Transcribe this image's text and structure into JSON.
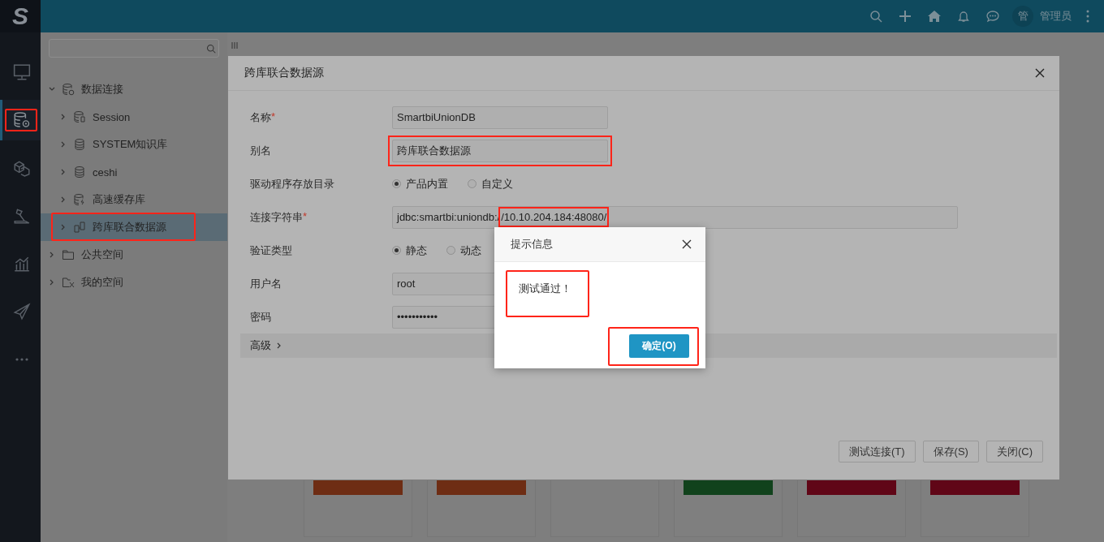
{
  "topbar": {
    "logo": "S",
    "avatar": "管",
    "user": "管理员"
  },
  "rail": [
    {
      "kind": "monitor",
      "selected": false,
      "highlighted": false
    },
    {
      "kind": "database-gear",
      "selected": true,
      "highlighted": true
    },
    {
      "kind": "cubes",
      "selected": false,
      "highlighted": false
    },
    {
      "kind": "tool",
      "selected": false,
      "highlighted": false
    },
    {
      "kind": "chart",
      "selected": false,
      "highlighted": false
    },
    {
      "kind": "plane",
      "selected": false,
      "highlighted": false
    },
    {
      "kind": "more",
      "selected": false,
      "highlighted": false
    }
  ],
  "tree": [
    {
      "label": "数据连接",
      "kind": "group",
      "expanded": true,
      "selected": false,
      "highlighted": false,
      "children": [
        {
          "label": "Session",
          "kind": "session",
          "expanded": false,
          "selected": false,
          "highlighted": false
        },
        {
          "label": "SYSTEM知识库",
          "kind": "database",
          "expanded": false,
          "selected": false,
          "highlighted": false
        },
        {
          "label": "ceshi",
          "kind": "database",
          "expanded": false,
          "selected": false,
          "highlighted": false
        },
        {
          "label": "高速缓存库",
          "kind": "cache",
          "expanded": false,
          "selected": false,
          "highlighted": false
        },
        {
          "label": "跨库联合数据源",
          "kind": "union",
          "expanded": false,
          "selected": true,
          "highlighted": true
        }
      ]
    },
    {
      "label": "公共空间",
      "kind": "folder",
      "expanded": false,
      "selected": false,
      "highlighted": false
    },
    {
      "label": "我的空间",
      "kind": "personal",
      "expanded": false,
      "selected": false,
      "highlighted": false
    }
  ],
  "cards": [
    {
      "kind": "strip",
      "color": "#6e2d14"
    },
    {
      "kind": "strip",
      "color": "#6e2d14"
    },
    {
      "kind": "blank"
    },
    {
      "kind": "strip",
      "color": "#11421c"
    },
    {
      "kind": "strip",
      "color": "#600617"
    },
    {
      "kind": "strip",
      "color": "#600617"
    }
  ],
  "dialog": {
    "title": "跨库联合数据源",
    "rows": [
      {
        "kind": "text",
        "label": "名称",
        "required_mark": "*",
        "highlighted": false,
        "value_parts": [
          {
            "text": "SmartbiUnionDB",
            "highlighted": false
          }
        ]
      },
      {
        "kind": "text",
        "label": "别名",
        "highlighted": true,
        "value_parts": [
          {
            "text": "跨库联合数据源",
            "highlighted": false
          }
        ]
      },
      {
        "kind": "radio",
        "label": "驱动程序存放目录",
        "options": [
          {
            "label": "产品内置",
            "selected": true
          },
          {
            "label": "自定义",
            "selected": false
          }
        ]
      },
      {
        "kind": "wide",
        "label": "连接字符串",
        "required_mark": "*",
        "highlighted": false,
        "value_parts": [
          {
            "text": "jdbc:smartbi:uniondb:/",
            "highlighted": false
          },
          {
            "text": "/10.10.204.184:48080/",
            "highlighted": true
          }
        ]
      },
      {
        "kind": "radio",
        "label": "验证类型",
        "options": [
          {
            "label": "静态",
            "selected": true
          },
          {
            "label": "动态",
            "selected": false
          }
        ]
      },
      {
        "kind": "text",
        "label": "用户名",
        "highlighted": false,
        "value_parts": [
          {
            "text": "root",
            "highlighted": false
          }
        ]
      },
      {
        "kind": "text",
        "label": "密码",
        "highlighted": false,
        "value_parts": [
          {
            "text": "•••••••••••",
            "highlighted": false
          }
        ]
      }
    ],
    "advanced": "高级",
    "buttons": [
      "测试连接(T)",
      "保存(S)",
      "关闭(C)"
    ]
  },
  "alert": {
    "title": "提示信息",
    "message": "测试通过！",
    "message_highlighted": true,
    "ok": "确定(O)",
    "ok_highlighted": true
  }
}
